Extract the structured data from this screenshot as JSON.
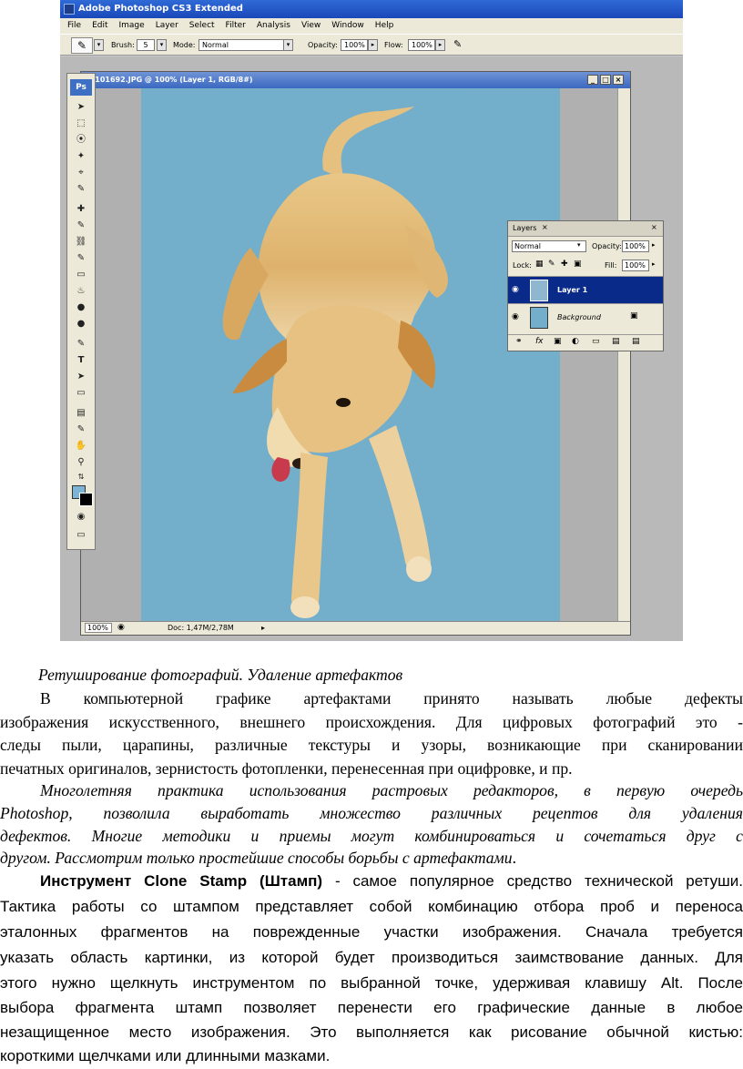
{
  "window": {
    "app_title": "Adobe Photoshop CS3 Extended",
    "menu": [
      "File",
      "Edit",
      "Image",
      "Layer",
      "Select",
      "Filter",
      "Analysis",
      "View",
      "Window",
      "Help"
    ]
  },
  "options_bar": {
    "brush_label": "Brush:",
    "brush_size": "5",
    "mode_label": "Mode:",
    "mode_value": "Normal",
    "opacity_label": "Opacity:",
    "opacity_value": "100%",
    "flow_label": "Flow:",
    "flow_value": "100%"
  },
  "tools": {
    "logo": "Ps",
    "icons": [
      "move-tool-icon",
      "marquee-tool-icon",
      "lasso-tool-icon",
      "magic-wand-icon",
      "crop-tool-icon",
      "slice-tool-icon",
      "healing-brush-icon",
      "brush-tool-icon",
      "clone-stamp-icon",
      "history-brush-icon",
      "eraser-icon",
      "paint-bucket-icon",
      "blur-tool-icon",
      "dodge-tool-icon",
      "pen-tool-icon",
      "type-tool-icon",
      "path-select-icon",
      "shape-tool-icon",
      "notes-tool-icon",
      "eyedropper-icon",
      "hand-tool-icon",
      "zoom-tool-icon"
    ],
    "foreground_color": "#7db4d6",
    "background_color": "#000000"
  },
  "document": {
    "title": "p0101692.JPG @ 100% (Layer 1, RGB/8#)",
    "zoom": "100%",
    "doc_size": "Doc: 1,47M/2,78M"
  },
  "layers_panel": {
    "tab": "Layers",
    "blend_mode": "Normal",
    "opacity_label": "Opacity:",
    "opacity": "100%",
    "lock_label": "Lock:",
    "fill_label": "Fill:",
    "fill": "100%",
    "layers": [
      {
        "name": "Layer 1",
        "selected": true
      },
      {
        "name": "Background",
        "selected": false
      }
    ]
  },
  "text": {
    "caption": "Ретуширование фотографий. Удаление артефактов",
    "p1": [
      "В компьютерной графике артефактами принято называть любые дефекты",
      "изображения искусственного, внешнего происхождения. Для цифровых фотографий это -",
      "следы пыли, царапины, различные текстуры и узоры, возникающие при сканировании",
      "печатных оригиналов, зернистость фотопленки, перенесенная при оцифровке, и пр."
    ],
    "p2": [
      "Многолетняя практика использования растровых редакторов, в первую очередь",
      "Photoshop, позволила выработать множество различных рецептов для удаления",
      "дефектов. Многие методики и приемы могут комбинироваться и сочетаться друг с",
      "другом. Рассмотрим только простейшие способы борьбы с артефактами"
    ],
    "p2_end": ".",
    "p3_bold": "Инструмент Clone Stamp (Штамп)",
    "p3_first_rest": " - самое популярное средство технической ретуши.",
    "p3": [
      "Тактика работы со штампом представляет собой комбинацию отбора проб и переноса",
      "эталонных фрагментов на поврежденные участки изображения. Сначала требуется",
      "указать область картинки, из которой будет производиться заимствование данных. Для",
      "этого нужно щелкнуть инструментом по выбранной точке, удерживая клавишу Alt. После",
      "выбора фрагмента штамп позволяет перенести его графические данные в любое",
      "незащищенное место изображения. Это выполняется как рисование обычной кистью:",
      "короткими щелчками или длинными мазками."
    ]
  }
}
